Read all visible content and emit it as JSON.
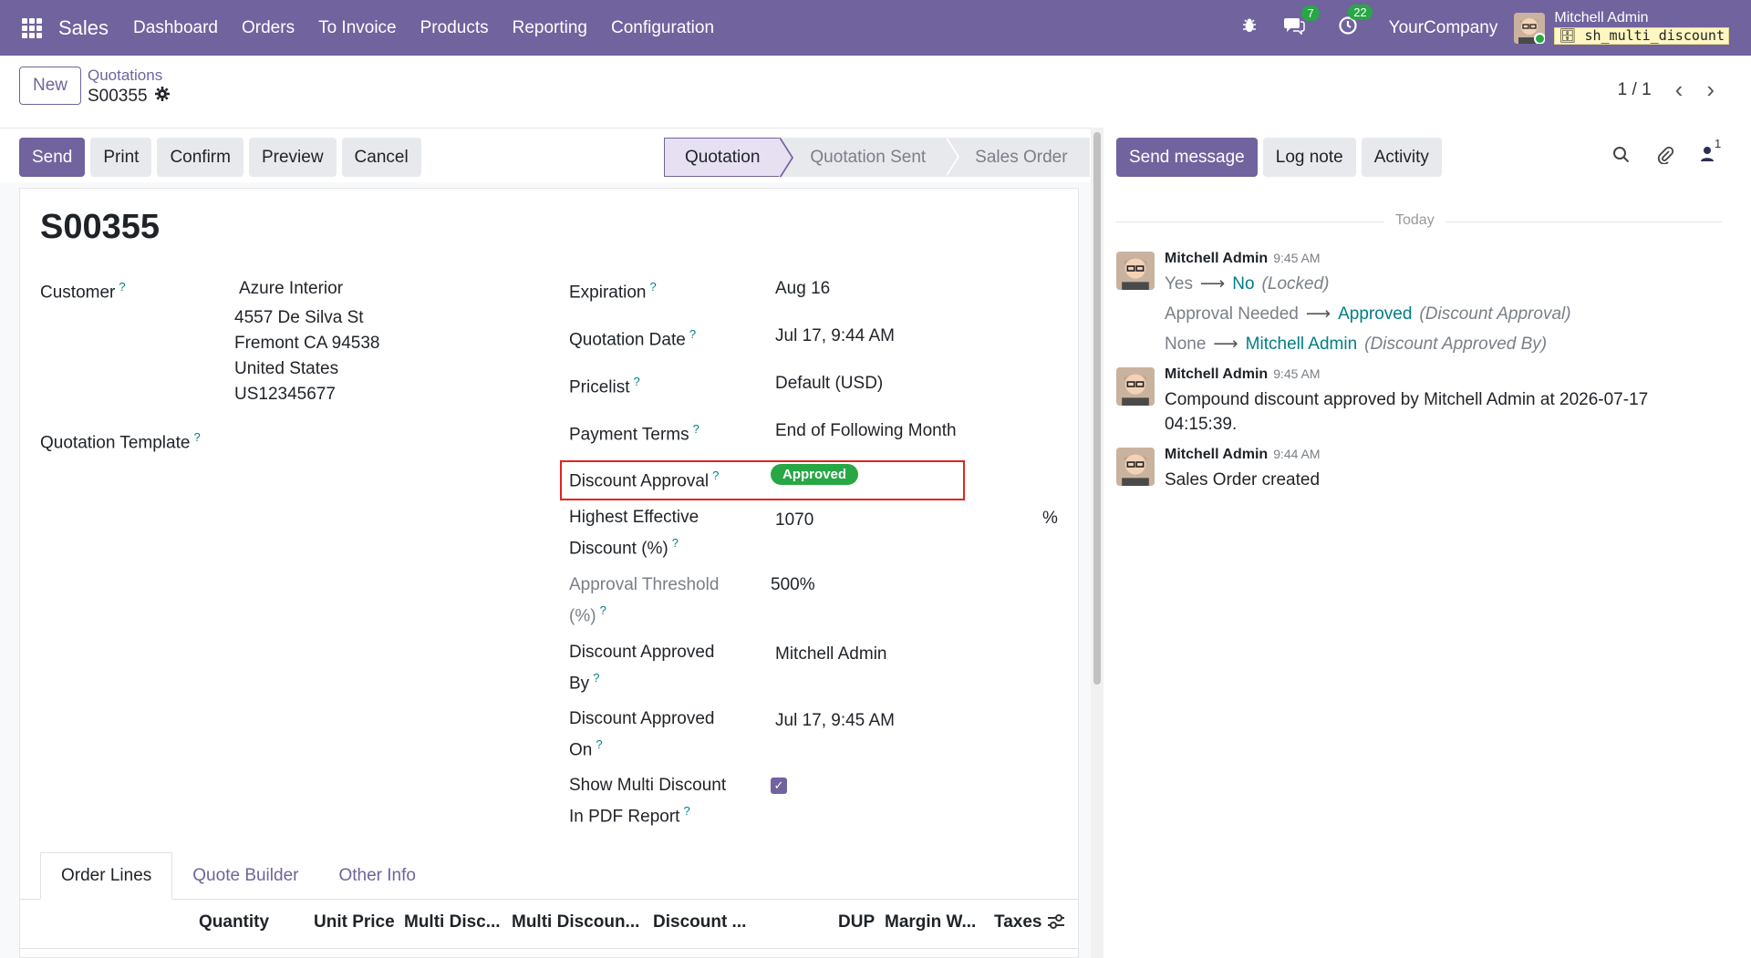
{
  "nav": {
    "app_name": "Sales",
    "menu": [
      "Dashboard",
      "Orders",
      "To Invoice",
      "Products",
      "Reporting",
      "Configuration"
    ],
    "messages_count": "7",
    "activities_count": "22",
    "company": "YourCompany",
    "user_name": "Mitchell Admin",
    "database": "sh_multi_discount"
  },
  "breadcrumb": {
    "new_label": "New",
    "parent": "Quotations",
    "current": "S00355"
  },
  "pager": {
    "text": "1 / 1"
  },
  "actions": [
    "Send",
    "Print",
    "Confirm",
    "Preview",
    "Cancel"
  ],
  "status": {
    "stages": [
      "Quotation",
      "Quotation Sent",
      "Sales Order"
    ],
    "active": "Quotation"
  },
  "form": {
    "title": "S00355",
    "customer_label": "Customer",
    "customer_name": "Azure Interior",
    "address_1": "4557 De Silva St",
    "address_2": "Fremont CA 94538",
    "address_3": "United States",
    "address_4": "US12345677",
    "template_label": "Quotation Template",
    "expiration_label": "Expiration",
    "expiration": "Aug 16",
    "quotation_date_label": "Quotation Date",
    "quotation_date": "Jul 17, 9:44 AM",
    "pricelist_label": "Pricelist",
    "pricelist": "Default (USD)",
    "payment_terms_label": "Payment Terms",
    "payment_terms": "End of Following Month",
    "discount_approval_label": "Discount Approval",
    "discount_approval": "Approved",
    "highest_discount_label_1": "Highest Effective",
    "highest_discount_label_2": "Discount (%)",
    "highest_discount": "1070",
    "highest_discount_unit": "%",
    "threshold_label_1": "Approval Threshold",
    "threshold_label_2": "(%)",
    "threshold": "500%",
    "approved_by_label_1": "Discount Approved",
    "approved_by_label_2": "By",
    "approved_by": "Mitchell Admin",
    "approved_on_label_1": "Discount Approved",
    "approved_on_label_2": "On",
    "approved_on": "Jul 17, 9:45 AM",
    "show_multi_label_1": "Show Multi Discount",
    "show_multi_label_2": "In PDF Report",
    "show_multi_checked": true
  },
  "tabs": [
    "Order Lines",
    "Quote Builder",
    "Other Info"
  ],
  "order_columns": [
    "Quantity",
    "Unit Price",
    "Multi Disc...",
    "Multi Discoun...",
    "Discount ...",
    "DUP",
    "Margin W...",
    "Taxes"
  ],
  "chatter": {
    "buttons": [
      "Send message",
      "Log note",
      "Activity"
    ],
    "followers_count": "1",
    "date_separator": "Today",
    "messages": [
      {
        "author": "Mitchell Admin",
        "time": "9:45 AM",
        "changes": [
          {
            "old": "Yes",
            "new": "No",
            "field": "(Locked)"
          },
          {
            "old": "Approval Needed",
            "new": "Approved",
            "field": "(Discount Approval)"
          },
          {
            "old": "None",
            "new": "Mitchell Admin",
            "field": "(Discount Approved By)"
          }
        ]
      },
      {
        "author": "Mitchell Admin",
        "time": "9:45 AM",
        "body_line1": "Compound discount approved by Mitchell Admin at 2026-07-17",
        "body_line2": "04:15:39."
      },
      {
        "author": "Mitchell Admin",
        "time": "9:44 AM",
        "body_line1": "Sales Order created"
      }
    ]
  },
  "colors": {
    "brand": "#71639e",
    "success": "#28a745",
    "link": "#017e84",
    "highlight": "#e02424"
  }
}
